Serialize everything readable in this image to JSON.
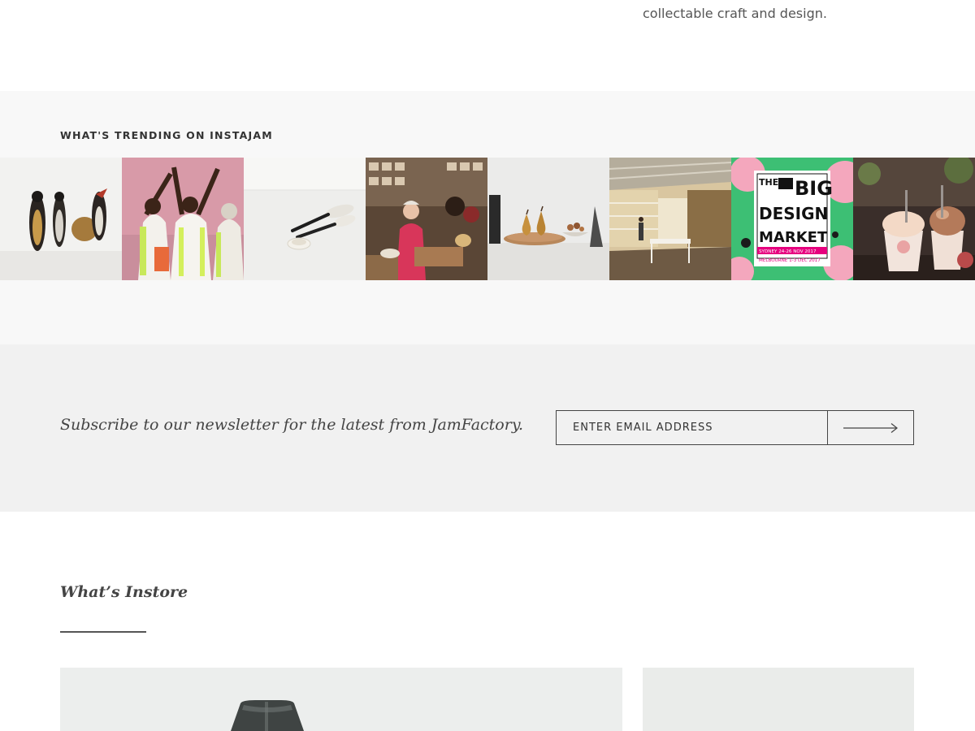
{
  "intro": {
    "text_line1": "collectable craft and design."
  },
  "trending": {
    "heading": "WHAT'S TRENDING ON INSTAJAM",
    "tiles": [
      {
        "subject": "carved penguin figurines"
      },
      {
        "subject": "women dancing in painted dresses"
      },
      {
        "subject": "ceramic spoons on marble"
      },
      {
        "subject": "workshop with ceramics"
      },
      {
        "subject": "pears on wooden plate"
      },
      {
        "subject": "gallery store interior"
      },
      {
        "subject": "the big design market poster"
      },
      {
        "subject": "gelato cups"
      }
    ],
    "market_poster": {
      "line1": "THE",
      "line2": "BIG",
      "line3": "DESIGN",
      "line4": "MARKET",
      "dates1": "SYDNEY 24-26 NOV 2017",
      "dates2": "MELBOURNE 1-3 DEC 2017"
    }
  },
  "newsletter": {
    "text": "Subscribe to our newsletter for the latest from JamFactory.",
    "placeholder": "ENTER EMAIL ADDRESS",
    "submit_icon": "arrow-right-icon"
  },
  "instore": {
    "title": "What’s Instore"
  },
  "colors": {
    "trending_bg": "#f8f8f8",
    "newsletter_bg": "#f1f1f1",
    "poster_pink": "#e6007e",
    "poster_green": "#3dbf74"
  }
}
